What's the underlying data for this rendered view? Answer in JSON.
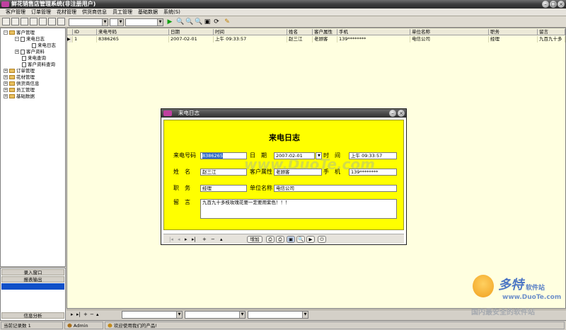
{
  "app": {
    "title": "鲜花销售店管理系统(非注册用户)"
  },
  "menu": [
    "客户管理",
    "订单管理",
    "花材管理",
    "供货商信息",
    "员工管理",
    "基础数据",
    "系统(S)"
  ],
  "tree": {
    "root": "客户管理",
    "items": [
      {
        "label": "来电日志",
        "level": 1
      },
      {
        "label": "来电日志",
        "level": 2
      },
      {
        "label": "客户资料",
        "level": 1
      },
      {
        "label": "来电查询",
        "level": 1
      },
      {
        "label": "客户资料查询",
        "level": 1
      },
      {
        "label": "订单管理",
        "level": 0
      },
      {
        "label": "花材管理",
        "level": 0
      },
      {
        "label": "供货商信息",
        "level": 0
      },
      {
        "label": "员工管理",
        "level": 0
      },
      {
        "label": "基础数据",
        "level": 0
      }
    ]
  },
  "navpanel": {
    "btn1": "录入窗口",
    "btn2": "报表输出",
    "btn3": "信息分析"
  },
  "grid": {
    "headers": [
      "ID",
      "来电号码",
      "日期",
      "时间",
      "姓名",
      "客户属性",
      "手机",
      "单位名称",
      "职务",
      "留言"
    ],
    "row": [
      "1",
      "8386265",
      "2007-02-01",
      "上午 09:33:57",
      "赵三江",
      "老顾客",
      "139********",
      "电信公司",
      "经理",
      "九百九十多"
    ]
  },
  "dialog": {
    "title": "来电日志",
    "heading": "来电日志",
    "labels": {
      "phone": "来电号码",
      "date": "日　期",
      "time": "时　间",
      "name": "姓　名",
      "attr": "客户属性",
      "mobile": "手　机",
      "position": "职　务",
      "company": "单位名称",
      "message": "留　言"
    },
    "values": {
      "phone": "8386265",
      "date": "2007-02-01",
      "time": "上午 09:33:57",
      "name": "赵三江",
      "attr": "老顾客",
      "mobile": "139********",
      "position": "经理",
      "company": "电信公司",
      "message": "九百九十多枝玫瑰花要一定要用紫色！！！"
    },
    "add_button": "增加"
  },
  "status": {
    "records": "当前记录数 1",
    "user": "Admin",
    "message": "欢迎使用我们的产品!"
  },
  "watermark": {
    "brand": "多特",
    "brand_sub": "软件站",
    "url": "www.DuoTe.com",
    "slogan": "国内最安全的软件站",
    "mid": "www.DuoTe.com"
  }
}
